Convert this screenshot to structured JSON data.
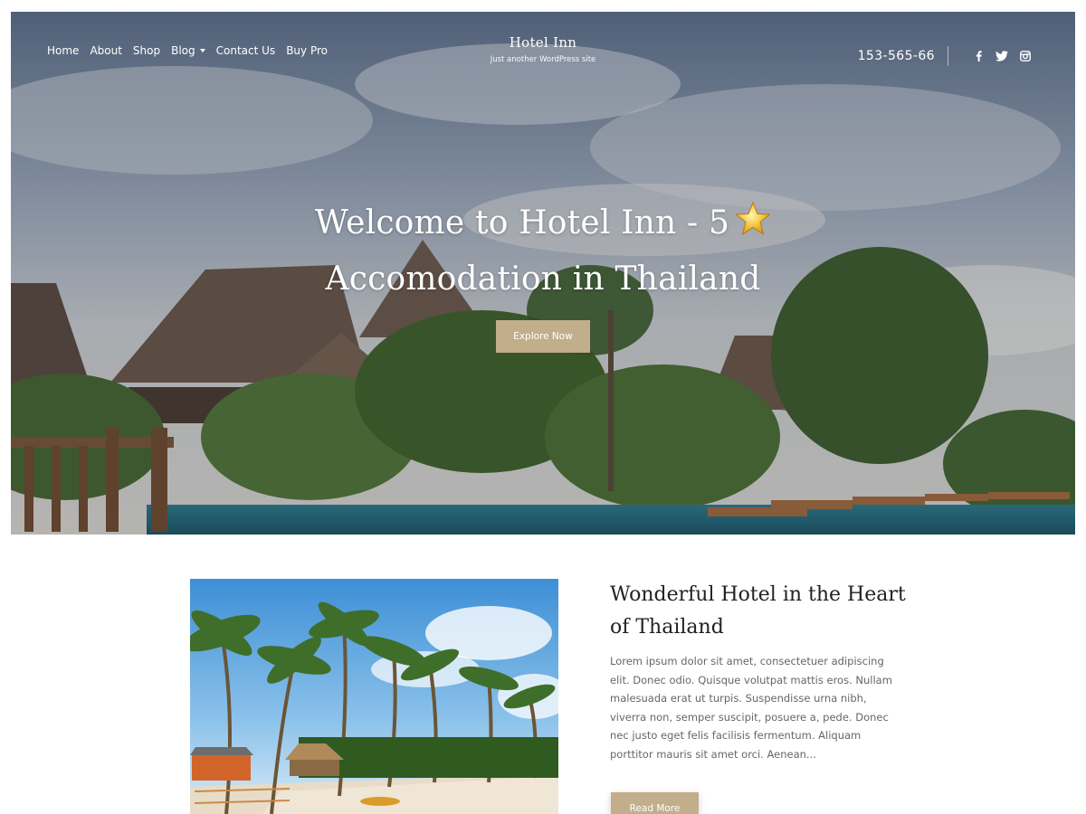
{
  "nav": {
    "items": [
      {
        "label": "Home"
      },
      {
        "label": "About"
      },
      {
        "label": "Shop"
      },
      {
        "label": "Blog",
        "has_dropdown": true
      },
      {
        "label": "Contact Us"
      },
      {
        "label": "Buy Pro"
      }
    ]
  },
  "brand": {
    "title": "Hotel Inn",
    "tagline": "Just another WordPress site"
  },
  "header": {
    "phone": "153-565-66",
    "social_icons": [
      "facebook-icon",
      "twitter-icon",
      "instagram-icon"
    ]
  },
  "hero": {
    "title_line1": "Welcome to Hotel Inn - 5",
    "title_line2": "Accomodation in Thailand",
    "title_icon": "star-icon",
    "button_label": "Explore Now"
  },
  "feature": {
    "title": "Wonderful Hotel in the Heart of Thailand",
    "text": "Lorem ipsum dolor sit amet, consectetuer adipiscing elit. Donec odio. Quisque volutpat mattis eros. Nullam malesuada erat ut turpis. Suspendisse urna nibh, viverra non, semper suscipit, posuere a, pede. Donec nec justo eget felis facilisis fermentum. Aliquam porttitor mauris sit amet orci. Aenean...",
    "button_label": "Read More"
  },
  "colors": {
    "accent": "#c2ae8a",
    "heading": "#222222",
    "body_text": "#666666"
  }
}
